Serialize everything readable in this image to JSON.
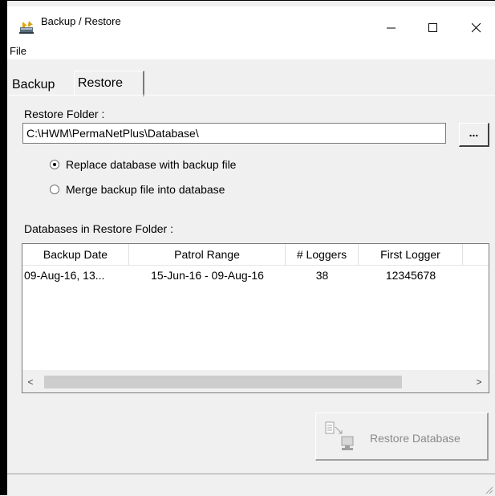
{
  "window": {
    "title": "Backup / Restore",
    "controls": {
      "minimize": "–",
      "maximize": "☐",
      "close": "✕"
    }
  },
  "menu": {
    "file": "File"
  },
  "tabs": [
    {
      "label": "Backup",
      "active": false
    },
    {
      "label": "Restore",
      "active": true
    }
  ],
  "restore": {
    "folder_label": "Restore Folder :",
    "folder_path": "C:\\HWM\\PermaNetPlus\\Database\\",
    "browse_label": "...",
    "options": [
      {
        "label": "Replace database with backup file",
        "selected": true
      },
      {
        "label": "Merge backup file into database",
        "selected": false
      }
    ],
    "databases_label": "Databases in Restore Folder :",
    "columns": [
      "Backup Date",
      "Patrol Range",
      "# Loggers",
      "First Logger"
    ],
    "rows": [
      [
        "09-Aug-16, 13...",
        "15-Jun-16 - 09-Aug-16",
        "38",
        "12345678"
      ]
    ],
    "scroll_left": "<",
    "scroll_right": ">",
    "restore_button": "Restore Database",
    "restore_button_enabled": false
  },
  "colors": {
    "window_bg": "#f0f0f0",
    "titlebar_bg": "#ffffff",
    "disabled_text": "#8a8a8a"
  }
}
